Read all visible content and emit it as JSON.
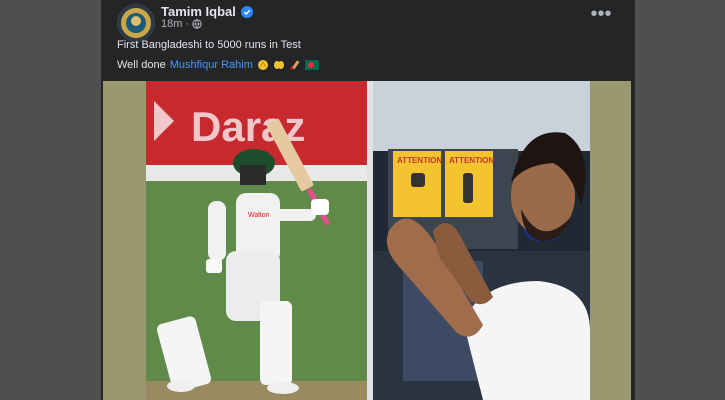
{
  "post": {
    "author": "Tamim Iqbal",
    "time": "18m",
    "line1": "First Bangladeshi to 5000 runs in Test",
    "line2_prefix": "Well done",
    "mention": "Mushfiqur Rahim",
    "emojis": [
      "clapping-hands",
      "raised-hands",
      "cricket-bat",
      "bangladesh-flag"
    ]
  },
  "media": {
    "left_photo": {
      "banner_text": "Daraz",
      "jersey_text": "Walton"
    },
    "right_photo": {
      "sign_texts": [
        "ATTENTION",
        "ATTENTION"
      ]
    }
  },
  "colors": {
    "card_bg": "#242526",
    "link": "#4599ff",
    "verified": "#2d88ff",
    "page_bg": "#4e4f50"
  }
}
